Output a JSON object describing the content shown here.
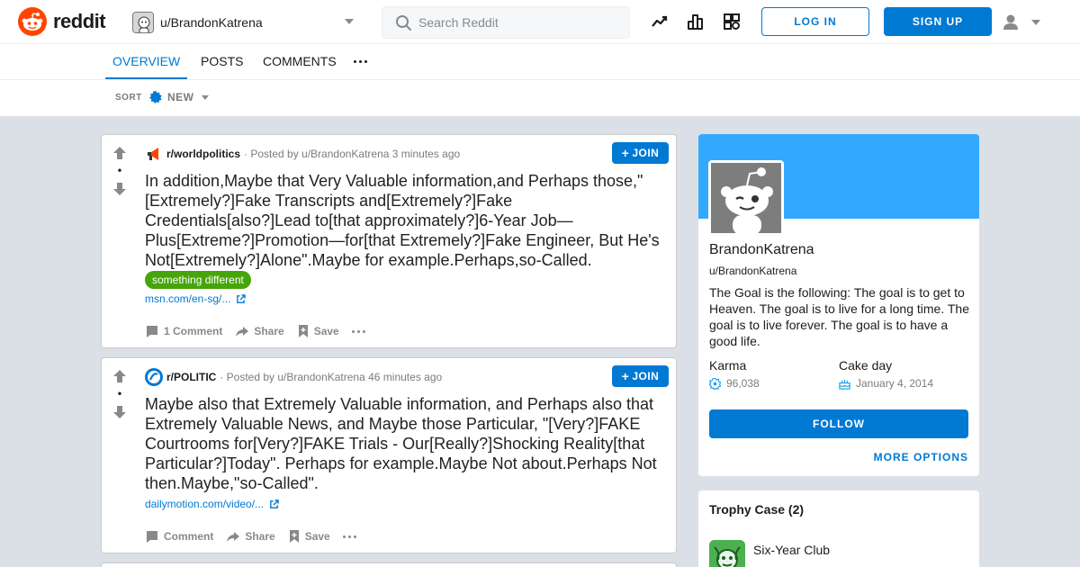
{
  "header": {
    "logo_text": "reddit",
    "profile_dropdown": "u/BrandonKatrena",
    "search_placeholder": "Search Reddit",
    "login_label": "LOG IN",
    "signup_label": "SIGN UP",
    "icons": [
      "trending-icon",
      "leaderboard-icon",
      "topics-icon",
      "user-icon",
      "chevron-down-icon"
    ]
  },
  "tabs": [
    {
      "label": "OVERVIEW",
      "active": true
    },
    {
      "label": "POSTS",
      "active": false
    },
    {
      "label": "COMMENTS",
      "active": false
    }
  ],
  "sort": {
    "label": "SORT",
    "value": "NEW"
  },
  "posts": [
    {
      "subreddit": "r/worldpolitics",
      "meta": "· Posted by u/BrandonKatrena 3 minutes ago",
      "score": "•",
      "join_label": "JOIN",
      "title": "In addition,Maybe that Very Valuable information,and Perhaps those,\"[Extremely?]Fake Transcripts and[Extremely?]Fake Credentials[also?]Lead to[that approximately?]6-Year Job—Plus[Extreme?]Promotion—for[that Extremely?]Fake Engineer, But He's Not[Extremely?]Alone\".Maybe for example.Perhaps,so-Called.",
      "flair": "something different",
      "link": "msn.com/en-sg/...",
      "comment_label": "1 Comment",
      "share_label": "Share",
      "save_label": "Save"
    },
    {
      "subreddit": "r/POLITIC",
      "meta": "· Posted by u/BrandonKatrena 46 minutes ago",
      "score": "•",
      "join_label": "JOIN",
      "title": "Maybe also that Extremely Valuable information, and Perhaps also that Extremely Valuable News, and Maybe those Particular, \"[Very?]FAKE Courtrooms for[Very?]FAKE Trials - Our[Really?]Shocking Reality[that Particular?]Today\". Perhaps for example.Maybe Not about.Perhaps Not then.Maybe,\"so-Called\".",
      "link": "dailymotion.com/video/...",
      "comment_label": "Comment",
      "share_label": "Share",
      "save_label": "Save"
    }
  ],
  "profile": {
    "display_name": "BrandonKatrena",
    "handle": "u/BrandonKatrena",
    "bio": "The Goal is the following: The goal is to get to Heaven. The goal is to live for a long time. The goal is to live forever. The goal is to have a good life.",
    "karma_label": "Karma",
    "karma_value": "96,038",
    "cakeday_label": "Cake day",
    "cakeday_value": "January 4, 2014",
    "follow_label": "FOLLOW",
    "more_options_label": "MORE OPTIONS"
  },
  "trophy_case": {
    "title": "Trophy Case (2)",
    "items": [
      {
        "name": "Six-Year Club"
      }
    ]
  },
  "colors": {
    "accent": "#0079d3",
    "brand": "#ff4500",
    "banner": "#33a8ff",
    "flair": "#46a508",
    "background": "#dae0e6"
  }
}
